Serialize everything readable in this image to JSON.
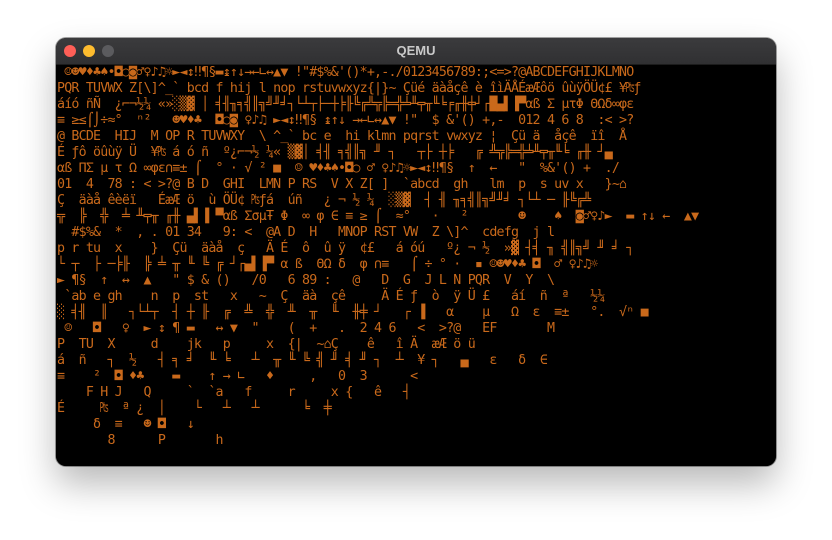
{
  "window": {
    "title": "QEMU"
  },
  "colors": {
    "foreground": "#c9691b",
    "background": "#000000"
  },
  "screen": {
    "lines": [
      " ☺☻♥♦♣♠•◘○◙♂♀♪♫☼►◄↕‼¶§▬↨↑↓→←∟↔▲▼ !\"#$%&'()*+,-./0123456789:;<=>?@ABCDEFGHIJKLMNO",
      "PQR TUVWX Z[\\]^_` bcd f hij l nop rstuvwxyz{|}~ Çüé äàåçê è îìÄÅÉæÆôö ûùÿÖÜ¢£ ¥₧ƒ",
      "áíó ñÑ  ¿⌐¬½¼ «»░▒▓ │ ╡╢╖╕╣║╗╝╜╛┐└┴┬├─┼╞╟╚╔╩╦╠═╬╧╨╤╥╙╘╒╓╫╪┘┌█▄▌▐▀αß Σ µτΦ ΘΩδ∞φε",
      "≡ ≥≤⌠⌡÷≈°  ⁿ²   ☻♥♦♣  ◘○◙ ♀♪♫ ►◄↕‼¶§ ↨↑↓ →←∟↔▲▼ !\"  $ &'() +,-  012 4 6 8  :< >?",
      "@ BCDE  HIJ  M OP R TUVWXY  \\ ^_` bc e  hi klmn pqrst vwxyz ¦  Çü ä  åçê  ïî  Å",
      "É ƒô öûùÿ Ü  ¥₧ á ó ñ  º¿⌐¬½ ¼« ▒▓│ ╡╢ ╕╣║╗ ╜ ┐   ┬├ ┼╞   ╔ ╩╦╠═╬╧╨╤╥╙╘ ╓╫ ┘▄",
      "αß ΠΣ µ τ Ω ∞φε∩≡± ⌠  ° · √ ² ■  ☺ ♥♦♣♠•◘○ ♂ ♀♪♫☼►◄↕‼¶§  ↑  ←   \"  %&'() +  ./",
      "01  4  78 : < >?@ B D  GHI  LMN P RS  V X Z[ ]  `abcd  gh   lm  p  s uv x   }~⌂",
      "Ç  äàå êèëï   ÉæÆ ö  ù ÖÜ¢ ₧ƒá  úñ   ¿ ¬ ½ ¼  ░▒▓  ┤ ╢ ╖╕╣║╗╝╜╛ ┐└┴ ─ ╟╚╔╩",
      "╦  ╠  ╬  ╧ ╨╤╥ ╓╫ ▄▌▐ ▀αß ΣσµŦ Φ  ∞ φ ∈ ≡ ≥ ⌠  ≈°   ·   ²       ☻    ♠  ◙♂♀♪►  ▬ ↑↓ ←  ▲▼",
      "  #$%&  *  , . 01 34   9: <  @A D  H   MNOP RST VW  Z \\]^  cdefg  j l",
      "p r tu  x    }  Çü  äàå  ç   Ä É  ô  û ÿ  ¢£   á óú   º¿ ¬ ½  »▓ ┤╡ ╖ ╣║╗╝ ╜ ╛ ┐",
      "└ ┬  ├ ─╞╟  ╠ ╧ ╥ ╙ ╚ ╔ ┘┌▄▌▐▀ α ß  ΘΩ δ  φ ∩≡   ⌠ ÷ ° ·  ▪ ☺☻♥♦♣ ◘  ♂ ♀♪♫☼",
      "► ¶§  ↑  ↔  ▲   \" $ & ()   /0   6 89 :   @   D  G  J L N PQR  V  Y  \\",
      " `ab e gh    n  p  st   x   ~  Ç  äà  çê     Ä É ƒ  ò  ÿ Ü £   áí  ñ  ª   ½¼",
      "░ ╡╢  ║   ┐└┴┬  ┤ ┼ ╟  ╔  ╩  ╬  ╨  ╥  ╙  ╫╪ ┘   ┌ ▐   α    µ   Ω  ε  ≡±   °.  √ⁿ ■",
      " ☺   ◘   ♀  ► ↕ ¶ ▬   ↔ ▼  \"    (  +   .  2 4 6   <  >?@   EF       M",
      "P  TU  X     d    jk   p     x  {|  ~⌂Ç    ê   î Ä  æÆ ö ü",
      "á  ñ   ┐  ½   ┤ ╕ ╛  ╙ ╘   ┴  ╥ ╙ ╚ ╣ ╜ ╡ ╜ ┐  ┴  ¥ ┐   ▄   ε   δ  ∈",
      "≡    ²  ◘ ♦♣    ▬    ↑ → ∟   ♦     ,   0  3      <",
      "    F H J   Q     `  `a   f     r     x {   ê   ┤",
      "É     ₧  ª ¿  │    └   ┴   ┴      ╘  ╪",
      "     δ  ≡   ☻ ◘   ↓",
      "       8      P       h"
    ]
  }
}
